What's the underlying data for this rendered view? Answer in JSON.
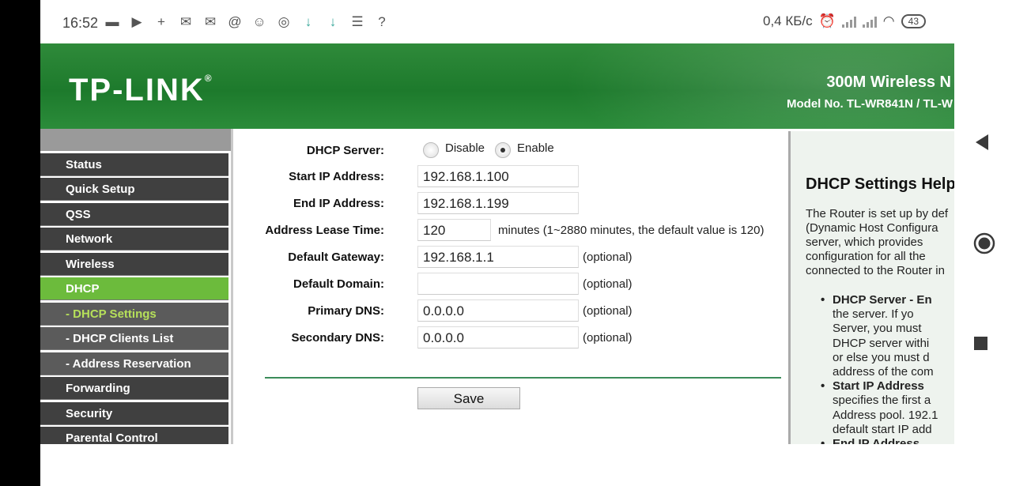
{
  "status_bar": {
    "time": "16:52",
    "speed": "0,4 КБ/с",
    "battery": "43",
    "icons": [
      "message-icon",
      "play-store-icon",
      "add-contact-icon",
      "mail-icon",
      "mail-icon",
      "at-icon",
      "emoji-icon",
      "instagram-icon",
      "download-icon",
      "download-icon",
      "menu-icon",
      "wifi-question-icon"
    ]
  },
  "header": {
    "logo": "TP-LINK",
    "product": "300M Wireless N",
    "model": "Model No. TL-WR841N / TL-W"
  },
  "menu": {
    "items": [
      {
        "label": "Status"
      },
      {
        "label": "Quick Setup"
      },
      {
        "label": "QSS"
      },
      {
        "label": "Network"
      },
      {
        "label": "Wireless"
      },
      {
        "label": "DHCP"
      },
      {
        "label": "- DHCP Settings"
      },
      {
        "label": "- DHCP Clients List"
      },
      {
        "label": "- Address Reservation"
      },
      {
        "label": "Forwarding"
      },
      {
        "label": "Security"
      },
      {
        "label": "Parental Control"
      }
    ]
  },
  "form": {
    "dhcp_server_label": "DHCP Server:",
    "disable_label": "Disable",
    "enable_label": "Enable",
    "start_ip_label": "Start IP Address:",
    "start_ip": "192.168.1.100",
    "end_ip_label": "End IP Address:",
    "end_ip": "192.168.1.199",
    "lease_label": "Address Lease Time:",
    "lease": "120",
    "lease_note": "minutes (1~2880 minutes, the default value is 120)",
    "gateway_label": "Default Gateway:",
    "gateway": "192.168.1.1",
    "domain_label": "Default Domain:",
    "domain": "",
    "primary_dns_label": "Primary DNS:",
    "primary_dns": "0.0.0.0",
    "secondary_dns_label": "Secondary DNS:",
    "secondary_dns": "0.0.0.0",
    "optional": "(optional)",
    "save_label": "Save"
  },
  "help": {
    "title": "DHCP Settings Help",
    "para": [
      "The Router is set up by def",
      "(Dynamic Host Configura",
      "server, which provides",
      "configuration for all the",
      "connected to the Router in"
    ],
    "item1_title": "DHCP Server - En",
    "item1": [
      "the server. If yo",
      "Server, you must",
      "DHCP server withi",
      "or else you must d",
      "address of the com"
    ],
    "item2_title": "Start IP Address",
    "item2": [
      "specifies the first a",
      "Address pool. 192.1",
      "default start IP add"
    ],
    "item3_title": "End IP Address"
  }
}
